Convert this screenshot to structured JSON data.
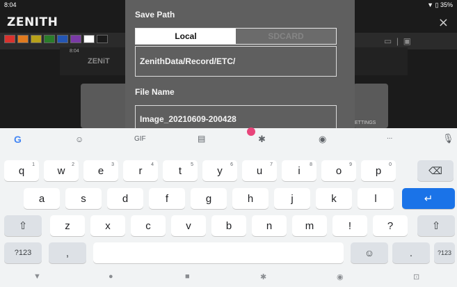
{
  "status": {
    "time": "8:04",
    "battery": "35%"
  },
  "app": {
    "logo": "ZENITH",
    "close": "×",
    "mini_time": "8:04",
    "mini_logo": "ZENiT",
    "settings_label": "ETTINGS"
  },
  "swatches": [
    "#d8322e",
    "#e07a1f",
    "#b8a11a",
    "#2a7c2a",
    "#2456b3",
    "#7a3aa6",
    "#ffffff",
    "#1b1b1b"
  ],
  "dialog": {
    "save_path_label": "Save Path",
    "tab_local": "Local",
    "tab_sdcard": "SDCARD",
    "path_value": "ZenithData/Record/ETC/",
    "file_name_label": "File Name",
    "file_name_value": "Image_20210609-200428"
  },
  "keyboard": {
    "suggestions": {
      "gif": "GIF",
      "more": "..."
    },
    "row1": [
      {
        "k": "q",
        "n": "1"
      },
      {
        "k": "w",
        "n": "2"
      },
      {
        "k": "e",
        "n": "3"
      },
      {
        "k": "r",
        "n": "4"
      },
      {
        "k": "t",
        "n": "5"
      },
      {
        "k": "y",
        "n": "6"
      },
      {
        "k": "u",
        "n": "7"
      },
      {
        "k": "i",
        "n": "8"
      },
      {
        "k": "o",
        "n": "9"
      },
      {
        "k": "p",
        "n": "0"
      }
    ],
    "row2": [
      "a",
      "s",
      "d",
      "f",
      "g",
      "h",
      "j",
      "k",
      "l"
    ],
    "row3": [
      "z",
      "x",
      "c",
      "v",
      "b",
      "n",
      "m",
      "!",
      "?"
    ],
    "symbols": "?123",
    "comma": ",",
    "period": ".",
    "enter": "↵",
    "shift": "⇧",
    "backspace": "⌫"
  }
}
